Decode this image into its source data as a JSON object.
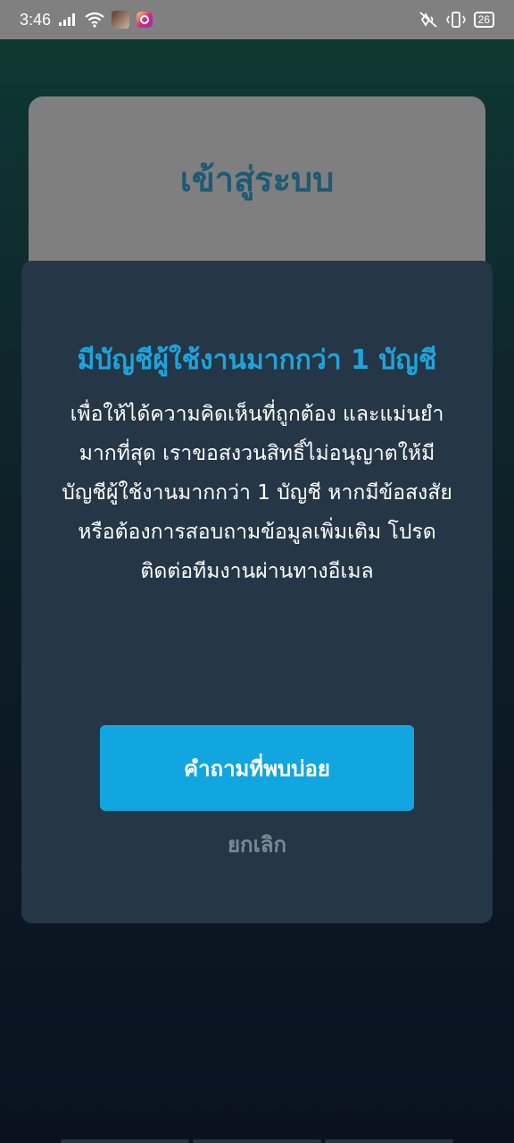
{
  "status_bar": {
    "time": "3:46",
    "battery": "26",
    "icons": [
      "signal-icon",
      "wifi-icon",
      "app-avatar-icon",
      "instagram-icon",
      "vibrate-off-icon",
      "vibrate-icon",
      "battery-icon"
    ]
  },
  "background_card": {
    "title": "เข้าสู่ระบบ"
  },
  "dialog": {
    "title": "มีบัญชีผู้ใช้งานมากกว่า 1 บัญชี",
    "body": "เพื่อให้ได้ความคิดเห็นที่ถูกต้อง และแม่นยำมากที่สุด เราขอสงวนสิทธิ์ไม่อนุญาตให้มีบัญชีผู้ใช้งานมากกว่า 1 บัญชี หากมีข้อสงสัย หรือต้องการสอบถามข้อมูลเพิ่มเติม โปรดติดต่อทีมงานผ่านทางอีเมล",
    "primary_button": "คำถามที่พบบ่อย",
    "cancel_label": "ยกเลิก"
  },
  "colors": {
    "accent": "#12a6e0",
    "title": "#1ea4dc",
    "dialog_bg": "#253646"
  }
}
